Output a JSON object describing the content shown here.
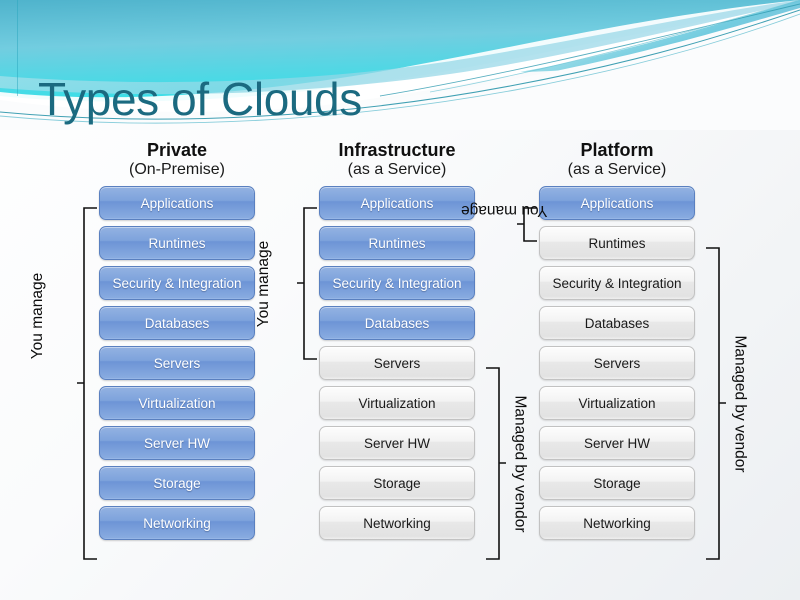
{
  "slide": {
    "title": "Types of Clouds",
    "theme_accent": "#1b6a80",
    "banner_colors": [
      "#3db7cc",
      "#6fd3e0",
      "#a9e4ec",
      "#1a7f94",
      "#ffffff"
    ],
    "background": "#f4f6f8"
  },
  "stack_rows": [
    "Applications",
    "Runtimes",
    "Security & Integration",
    "Databases",
    "Servers",
    "Virtualization",
    "Server HW",
    "Storage",
    "Networking"
  ],
  "colors": {
    "managed_by_you": "#7ea3dc",
    "managed_by_vendor": "#e8e8e8",
    "you_text": "#ffffff",
    "vendor_text": "#1a1a1a"
  },
  "columns": [
    {
      "id": "private",
      "heading_main": "Private",
      "heading_sub": "(On-Premise)",
      "rows": [
        {
          "label": "Applications",
          "owner": "you"
        },
        {
          "label": "Runtimes",
          "owner": "you"
        },
        {
          "label": "Security & Integration",
          "owner": "you"
        },
        {
          "label": "Databases",
          "owner": "you"
        },
        {
          "label": "Servers",
          "owner": "you"
        },
        {
          "label": "Virtualization",
          "owner": "you"
        },
        {
          "label": "Server HW",
          "owner": "you"
        },
        {
          "label": "Storage",
          "owner": "you"
        },
        {
          "label": "Networking",
          "owner": "you"
        }
      ],
      "brackets": [
        {
          "label": "You manage",
          "side": "left",
          "from_row": 1,
          "to_row": 9
        }
      ]
    },
    {
      "id": "iaas",
      "heading_main": "Infrastructure",
      "heading_sub": "(as a Service)",
      "rows": [
        {
          "label": "Applications",
          "owner": "you"
        },
        {
          "label": "Runtimes",
          "owner": "you"
        },
        {
          "label": "Security & Integration",
          "owner": "you"
        },
        {
          "label": "Databases",
          "owner": "you"
        },
        {
          "label": "Servers",
          "owner": "vendor"
        },
        {
          "label": "Virtualization",
          "owner": "vendor"
        },
        {
          "label": "Server HW",
          "owner": "vendor"
        },
        {
          "label": "Storage",
          "owner": "vendor"
        },
        {
          "label": "Networking",
          "owner": "vendor"
        }
      ],
      "brackets": [
        {
          "label": "You manage",
          "side": "left",
          "from_row": 1,
          "to_row": 4
        },
        {
          "label": "Managed by vendor",
          "side": "right",
          "from_row": 5,
          "to_row": 9
        }
      ]
    },
    {
      "id": "paas",
      "heading_main": "Platform",
      "heading_sub": "(as a Service)",
      "rows": [
        {
          "label": "Applications",
          "owner": "you"
        },
        {
          "label": "Runtimes",
          "owner": "vendor"
        },
        {
          "label": "Security & Integration",
          "owner": "vendor"
        },
        {
          "label": "Databases",
          "owner": "vendor"
        },
        {
          "label": "Servers",
          "owner": "vendor"
        },
        {
          "label": "Virtualization",
          "owner": "vendor"
        },
        {
          "label": "Server HW",
          "owner": "vendor"
        },
        {
          "label": "Storage",
          "owner": "vendor"
        },
        {
          "label": "Networking",
          "owner": "vendor"
        }
      ],
      "brackets": [
        {
          "label": "You manage",
          "side": "left",
          "from_row": 1,
          "to_row": 1
        },
        {
          "label": "Managed by vendor",
          "side": "right",
          "from_row": 2,
          "to_row": 9
        }
      ]
    }
  ]
}
